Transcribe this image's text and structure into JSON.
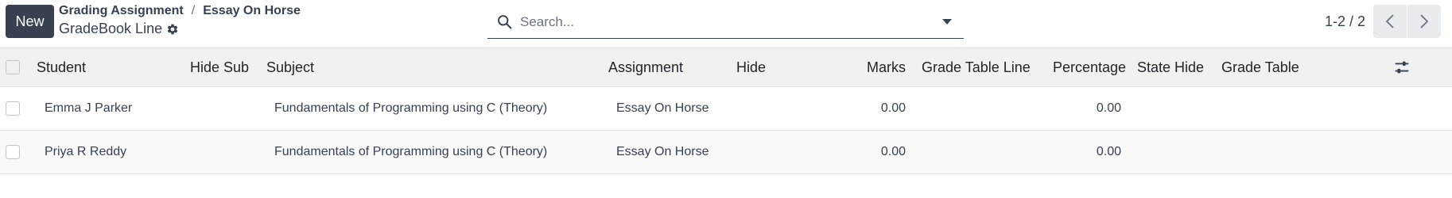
{
  "control_panel": {
    "new_button_label": "New",
    "breadcrumb": [
      {
        "label": "Grading Assignment"
      },
      {
        "label": "Essay On Horse"
      }
    ],
    "breadcrumb_separator": "/",
    "page_title": "GradeBook Line",
    "search": {
      "placeholder": "Search...",
      "value": ""
    },
    "pager": {
      "value": "1-2 / 2"
    }
  },
  "table": {
    "columns": {
      "student": "Student",
      "hide_sub": "Hide Sub",
      "subject": "Subject",
      "assignment": "Assignment",
      "hide": "Hide",
      "marks": "Marks",
      "grade_table_line": "Grade Table Line",
      "percentage": "Percentage",
      "state_hide": "State Hide",
      "grade_table": "Grade Table"
    },
    "rows": [
      {
        "student": "Emma J Parker",
        "hide_sub": "",
        "subject": "Fundamentals of Programming using C (Theory)",
        "assignment": "Essay On Horse",
        "hide": "",
        "marks": "0.00",
        "grade_table_line": "",
        "percentage": "0.00",
        "state_hide": "",
        "grade_table": ""
      },
      {
        "student": "Priya R Reddy",
        "hide_sub": "",
        "subject": "Fundamentals of Programming using C (Theory)",
        "assignment": "Essay On Horse",
        "hide": "",
        "marks": "0.00",
        "grade_table_line": "",
        "percentage": "0.00",
        "state_hide": "",
        "grade_table": ""
      }
    ]
  },
  "icons": {
    "settings": "gear-icon",
    "search": "search-icon",
    "search_toggle": "caret-down-icon",
    "pager_prev": "chevron-left-icon",
    "pager_next": "chevron-right-icon",
    "optional_columns": "sliders-icon"
  },
  "colors": {
    "primary_button": "#374151",
    "header_background": "#f1f1f1",
    "pager_button_background": "#e9ecef",
    "border": "#dee2e6"
  }
}
